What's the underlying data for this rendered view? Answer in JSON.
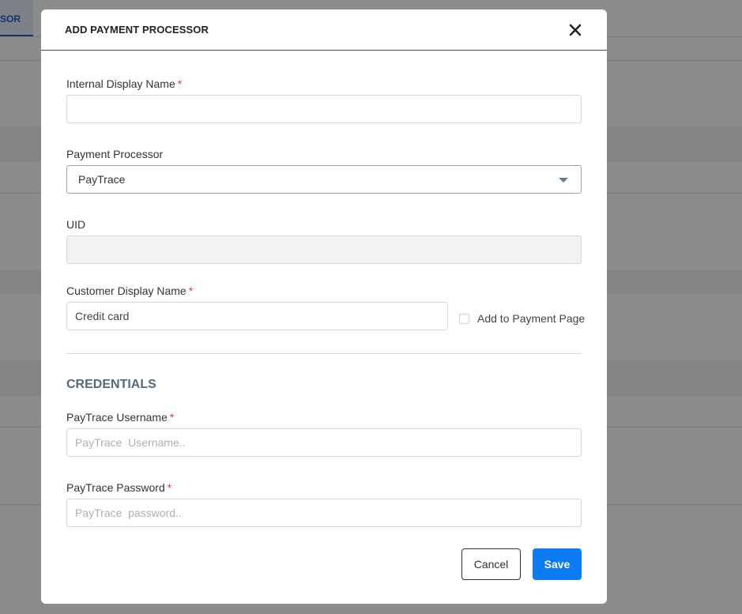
{
  "background": {
    "tab_label": "SOR"
  },
  "modal": {
    "title": "ADD PAYMENT PROCESSOR",
    "fields": {
      "internal_display_name": {
        "label": "Internal Display Name",
        "required_mark": "*",
        "value": ""
      },
      "payment_processor": {
        "label": "Payment Processor",
        "selected": "PayTrace"
      },
      "uid": {
        "label": "UID",
        "value": ""
      },
      "customer_display_name": {
        "label": "Customer Display Name",
        "required_mark": "*",
        "value": "Credit card"
      },
      "add_to_payment_page": {
        "label": "Add to Payment Page",
        "checked": false
      }
    },
    "credentials": {
      "title": "CREDENTIALS",
      "username": {
        "label": "PayTrace Username",
        "required_mark": "*",
        "placeholder": "PayTrace  Username.."
      },
      "password": {
        "label": "PayTrace Password",
        "required_mark": "*",
        "placeholder": "PayTrace  password.."
      }
    },
    "buttons": {
      "cancel": "Cancel",
      "save": "Save"
    }
  },
  "colors": {
    "primary": "#0d7cf2",
    "required": "#e53935",
    "section_title": "#54697d",
    "overlay": "rgba(0,0,0,0.45)"
  },
  "icons": {
    "close": "close-icon",
    "dropdown": "chevron-down-icon"
  }
}
